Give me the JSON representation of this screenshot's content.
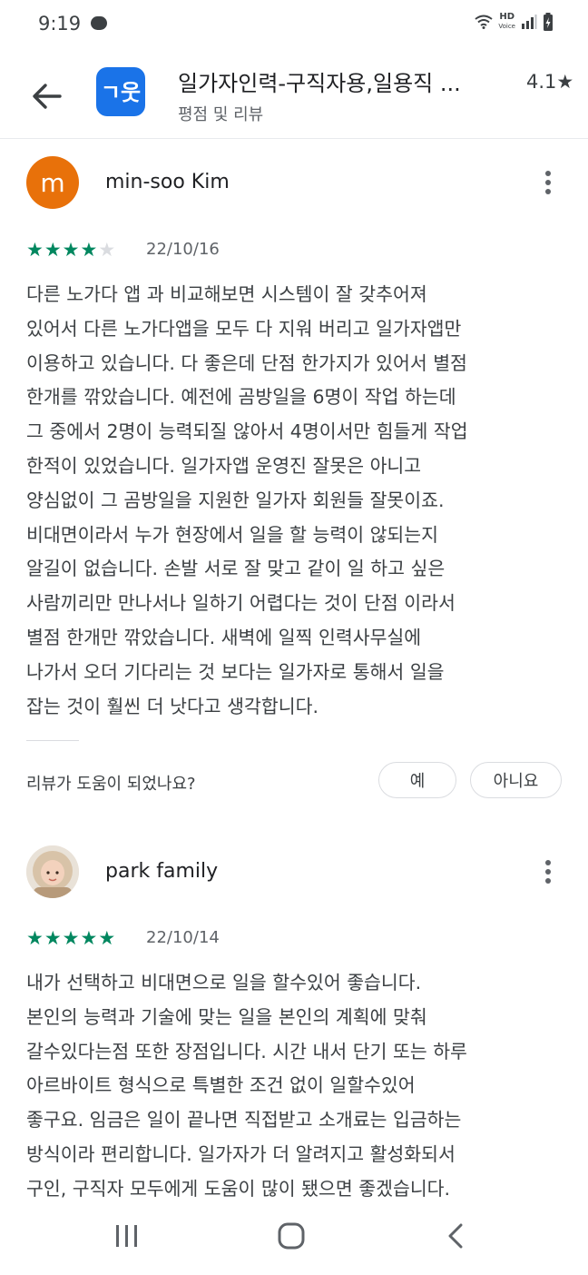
{
  "status": {
    "time": "9:19",
    "hd": "HD",
    "voice": "Voice"
  },
  "header": {
    "title": "일가자인력-구직자용,일용직 ...",
    "subtitle": "평점 및 리뷰",
    "rating": "4.1★",
    "app_icon_text": "ㄱ웃"
  },
  "reviews": [
    {
      "avatar_letter": "m",
      "avatar_color": "#e8710a",
      "author": "min-soo Kim",
      "stars": 4,
      "date": "22/10/16",
      "lines": [
        "다른 노가다 앱 과 비교해보면 시스템이 잘 갖추어져",
        "있어서 다른 노가다앱을 모두 다 지워 버리고 일가자앱만",
        "이용하고 있습니다. 다 좋은데 단점 한가지가 있어서 별점",
        "한개를 깎았습니다. 예전에 곰방일을 6명이 작업 하는데",
        "그 중에서 2명이 능력되질 않아서 4명이서만 힘들게 작업",
        "한적이 있었습니다. 일가자앱 운영진 잘못은 아니고",
        "양심없이 그 곰방일을 지원한 일가자 회원들 잘못이죠.",
        "비대면이라서 누가 현장에서 일을 할 능력이 않되는지",
        "알길이 없습니다. 손발 서로 잘 맞고 같이 일 하고 싶은",
        "사람끼리만 만나서나 일하기 어렵다는 것이 단점 이라서",
        "별점 한개만 깎았습니다. 새벽에 일찍 인력사무실에",
        "나가서 오더 기다리는 것 보다는 일가자로 통해서 일을",
        "잡는 것이 훨씬 더 낫다고 생각합니다."
      ],
      "helpful_question": "리뷰가 도움이 되었나요?",
      "yes": "예",
      "no": "아니요"
    },
    {
      "author": "park family",
      "stars": 5,
      "date": "22/10/14",
      "lines": [
        "내가 선택하고 비대면으로 일을 할수있어 좋습니다.",
        "본인의 능력과 기술에 맞는 일을 본인의 계획에 맞춰",
        "갈수있다는점 또한 장점입니다. 시간 내서 단기 또는 하루",
        "아르바이트 형식으로 특별한 조건 없이 일할수있어",
        "좋구요. 임금은 일이 끝나면 직접받고 소개료는 입금하는",
        "방식이라 편리합니다. 일가자가 더 알려지고 활성화되서",
        "구인, 구직자 모두에게 도움이 많이 됐으면 좋겠습니다."
      ]
    }
  ],
  "colors": {
    "star": "#01875f",
    "accent": "#1a73e8"
  }
}
